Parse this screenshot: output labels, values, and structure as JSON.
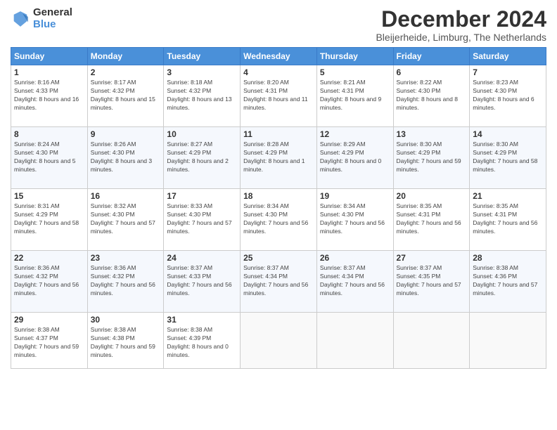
{
  "header": {
    "logo_general": "General",
    "logo_blue": "Blue",
    "month_title": "December 2024",
    "location": "Bleijerheide, Limburg, The Netherlands"
  },
  "weekdays": [
    "Sunday",
    "Monday",
    "Tuesday",
    "Wednesday",
    "Thursday",
    "Friday",
    "Saturday"
  ],
  "weeks": [
    [
      {
        "day": "1",
        "sunrise": "Sunrise: 8:16 AM",
        "sunset": "Sunset: 4:33 PM",
        "daylight": "Daylight: 8 hours and 16 minutes."
      },
      {
        "day": "2",
        "sunrise": "Sunrise: 8:17 AM",
        "sunset": "Sunset: 4:32 PM",
        "daylight": "Daylight: 8 hours and 15 minutes."
      },
      {
        "day": "3",
        "sunrise": "Sunrise: 8:18 AM",
        "sunset": "Sunset: 4:32 PM",
        "daylight": "Daylight: 8 hours and 13 minutes."
      },
      {
        "day": "4",
        "sunrise": "Sunrise: 8:20 AM",
        "sunset": "Sunset: 4:31 PM",
        "daylight": "Daylight: 8 hours and 11 minutes."
      },
      {
        "day": "5",
        "sunrise": "Sunrise: 8:21 AM",
        "sunset": "Sunset: 4:31 PM",
        "daylight": "Daylight: 8 hours and 9 minutes."
      },
      {
        "day": "6",
        "sunrise": "Sunrise: 8:22 AM",
        "sunset": "Sunset: 4:30 PM",
        "daylight": "Daylight: 8 hours and 8 minutes."
      },
      {
        "day": "7",
        "sunrise": "Sunrise: 8:23 AM",
        "sunset": "Sunset: 4:30 PM",
        "daylight": "Daylight: 8 hours and 6 minutes."
      }
    ],
    [
      {
        "day": "8",
        "sunrise": "Sunrise: 8:24 AM",
        "sunset": "Sunset: 4:30 PM",
        "daylight": "Daylight: 8 hours and 5 minutes."
      },
      {
        "day": "9",
        "sunrise": "Sunrise: 8:26 AM",
        "sunset": "Sunset: 4:30 PM",
        "daylight": "Daylight: 8 hours and 3 minutes."
      },
      {
        "day": "10",
        "sunrise": "Sunrise: 8:27 AM",
        "sunset": "Sunset: 4:29 PM",
        "daylight": "Daylight: 8 hours and 2 minutes."
      },
      {
        "day": "11",
        "sunrise": "Sunrise: 8:28 AM",
        "sunset": "Sunset: 4:29 PM",
        "daylight": "Daylight: 8 hours and 1 minute."
      },
      {
        "day": "12",
        "sunrise": "Sunrise: 8:29 AM",
        "sunset": "Sunset: 4:29 PM",
        "daylight": "Daylight: 8 hours and 0 minutes."
      },
      {
        "day": "13",
        "sunrise": "Sunrise: 8:30 AM",
        "sunset": "Sunset: 4:29 PM",
        "daylight": "Daylight: 7 hours and 59 minutes."
      },
      {
        "day": "14",
        "sunrise": "Sunrise: 8:30 AM",
        "sunset": "Sunset: 4:29 PM",
        "daylight": "Daylight: 7 hours and 58 minutes."
      }
    ],
    [
      {
        "day": "15",
        "sunrise": "Sunrise: 8:31 AM",
        "sunset": "Sunset: 4:29 PM",
        "daylight": "Daylight: 7 hours and 58 minutes."
      },
      {
        "day": "16",
        "sunrise": "Sunrise: 8:32 AM",
        "sunset": "Sunset: 4:30 PM",
        "daylight": "Daylight: 7 hours and 57 minutes."
      },
      {
        "day": "17",
        "sunrise": "Sunrise: 8:33 AM",
        "sunset": "Sunset: 4:30 PM",
        "daylight": "Daylight: 7 hours and 57 minutes."
      },
      {
        "day": "18",
        "sunrise": "Sunrise: 8:34 AM",
        "sunset": "Sunset: 4:30 PM",
        "daylight": "Daylight: 7 hours and 56 minutes."
      },
      {
        "day": "19",
        "sunrise": "Sunrise: 8:34 AM",
        "sunset": "Sunset: 4:30 PM",
        "daylight": "Daylight: 7 hours and 56 minutes."
      },
      {
        "day": "20",
        "sunrise": "Sunrise: 8:35 AM",
        "sunset": "Sunset: 4:31 PM",
        "daylight": "Daylight: 7 hours and 56 minutes."
      },
      {
        "day": "21",
        "sunrise": "Sunrise: 8:35 AM",
        "sunset": "Sunset: 4:31 PM",
        "daylight": "Daylight: 7 hours and 56 minutes."
      }
    ],
    [
      {
        "day": "22",
        "sunrise": "Sunrise: 8:36 AM",
        "sunset": "Sunset: 4:32 PM",
        "daylight": "Daylight: 7 hours and 56 minutes."
      },
      {
        "day": "23",
        "sunrise": "Sunrise: 8:36 AM",
        "sunset": "Sunset: 4:32 PM",
        "daylight": "Daylight: 7 hours and 56 minutes."
      },
      {
        "day": "24",
        "sunrise": "Sunrise: 8:37 AM",
        "sunset": "Sunset: 4:33 PM",
        "daylight": "Daylight: 7 hours and 56 minutes."
      },
      {
        "day": "25",
        "sunrise": "Sunrise: 8:37 AM",
        "sunset": "Sunset: 4:34 PM",
        "daylight": "Daylight: 7 hours and 56 minutes."
      },
      {
        "day": "26",
        "sunrise": "Sunrise: 8:37 AM",
        "sunset": "Sunset: 4:34 PM",
        "daylight": "Daylight: 7 hours and 56 minutes."
      },
      {
        "day": "27",
        "sunrise": "Sunrise: 8:37 AM",
        "sunset": "Sunset: 4:35 PM",
        "daylight": "Daylight: 7 hours and 57 minutes."
      },
      {
        "day": "28",
        "sunrise": "Sunrise: 8:38 AM",
        "sunset": "Sunset: 4:36 PM",
        "daylight": "Daylight: 7 hours and 57 minutes."
      }
    ],
    [
      {
        "day": "29",
        "sunrise": "Sunrise: 8:38 AM",
        "sunset": "Sunset: 4:37 PM",
        "daylight": "Daylight: 7 hours and 59 minutes."
      },
      {
        "day": "30",
        "sunrise": "Sunrise: 8:38 AM",
        "sunset": "Sunset: 4:38 PM",
        "daylight": "Daylight: 7 hours and 59 minutes."
      },
      {
        "day": "31",
        "sunrise": "Sunrise: 8:38 AM",
        "sunset": "Sunset: 4:39 PM",
        "daylight": "Daylight: 8 hours and 0 minutes."
      },
      {
        "day": "",
        "sunrise": "",
        "sunset": "",
        "daylight": ""
      },
      {
        "day": "",
        "sunrise": "",
        "sunset": "",
        "daylight": ""
      },
      {
        "day": "",
        "sunrise": "",
        "sunset": "",
        "daylight": ""
      },
      {
        "day": "",
        "sunrise": "",
        "sunset": "",
        "daylight": ""
      }
    ]
  ]
}
